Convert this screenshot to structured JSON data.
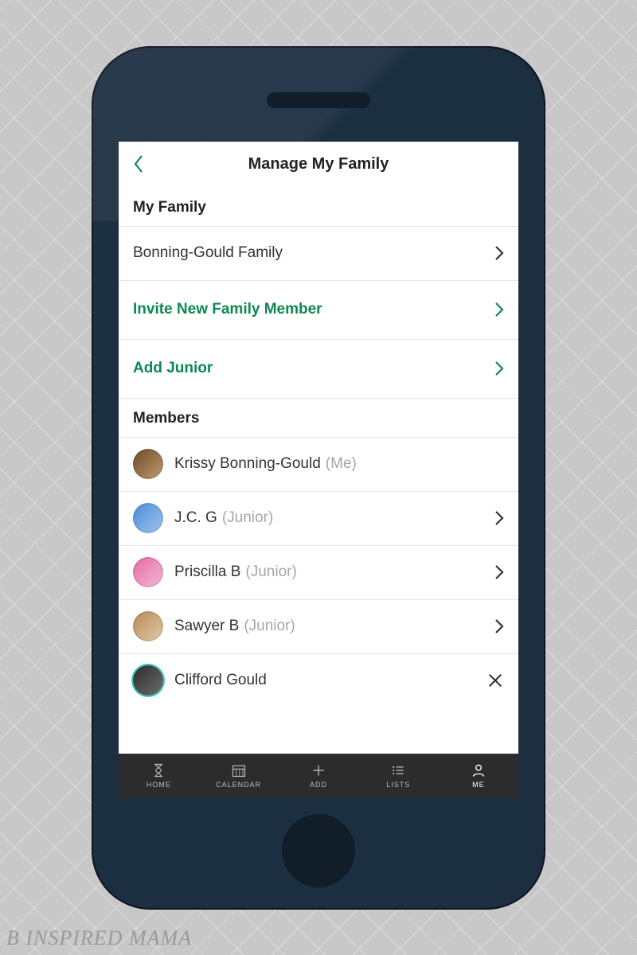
{
  "watermark": "B Inspired Mama",
  "header": {
    "title": "Manage My Family"
  },
  "sections": {
    "family": {
      "title": "My Family",
      "family_row": {
        "label": "Bonning-Gould Family"
      },
      "invite_row": {
        "label": "Invite New Family Member"
      },
      "add_junior_row": {
        "label": "Add Junior"
      }
    },
    "members": {
      "title": "Members",
      "items": [
        {
          "name": "Krissy Bonning-Gould",
          "suffix": "(Me)",
          "has_chevron": false,
          "has_x": false,
          "avatar_bg": "linear-gradient(135deg,#6b4a2b,#c49a6c)"
        },
        {
          "name": "J.C.  G",
          "suffix": "(Junior)",
          "has_chevron": true,
          "has_x": false,
          "avatar_bg": "linear-gradient(135deg,#4a8bd6,#9fc6ef)"
        },
        {
          "name": "Priscilla B",
          "suffix": "(Junior)",
          "has_chevron": true,
          "has_x": false,
          "avatar_bg": "linear-gradient(135deg,#e76aa8,#f4b9d3)"
        },
        {
          "name": "Sawyer B",
          "suffix": "(Junior)",
          "has_chevron": true,
          "has_x": false,
          "avatar_bg": "linear-gradient(135deg,#b58a57,#e3c9a8)"
        },
        {
          "name": "Clifford Gould",
          "suffix": "",
          "has_chevron": false,
          "has_x": true,
          "avatar_bg": "linear-gradient(135deg,#2b2b2b,#6d6d6d)",
          "ring": true
        }
      ]
    }
  },
  "tabbar": {
    "items": [
      {
        "label": "HOME",
        "active": false
      },
      {
        "label": "CALENDAR",
        "active": false
      },
      {
        "label": "ADD",
        "active": false
      },
      {
        "label": "LISTS",
        "active": false
      },
      {
        "label": "ME",
        "active": true
      }
    ]
  },
  "colors": {
    "accent_green": "#0c8950",
    "tabbar_bg": "#2c2c2c",
    "phone_body": "#1c2f41"
  }
}
